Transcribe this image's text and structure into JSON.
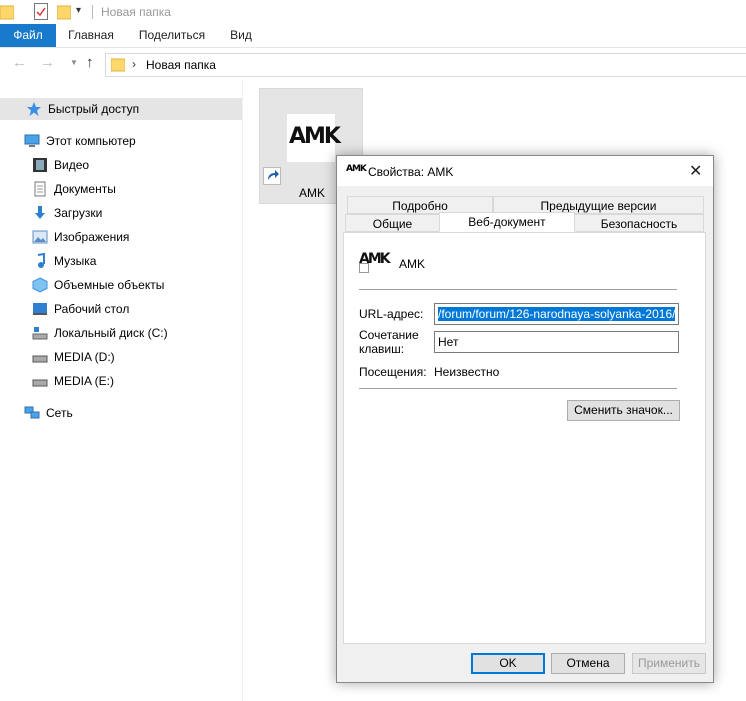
{
  "window": {
    "title": "Новая папка"
  },
  "ribbon": {
    "tabs": [
      "Файл",
      "Главная",
      "Поделиться",
      "Вид"
    ]
  },
  "address": {
    "path": "Новая папка"
  },
  "sidebar": {
    "items": [
      {
        "label": "Быстрый доступ",
        "icon": "star-icon"
      },
      {
        "label": "Этот компьютер",
        "icon": "computer-icon"
      },
      {
        "label": "Видео",
        "icon": "video-icon"
      },
      {
        "label": "Документы",
        "icon": "documents-icon"
      },
      {
        "label": "Загрузки",
        "icon": "download-icon"
      },
      {
        "label": "Изображения",
        "icon": "pictures-icon"
      },
      {
        "label": "Музыка",
        "icon": "music-icon"
      },
      {
        "label": "Объемные объекты",
        "icon": "3d-objects-icon"
      },
      {
        "label": "Рабочий стол",
        "icon": "desktop-icon"
      },
      {
        "label": "Локальный диск (C:)",
        "icon": "local-disk-icon"
      },
      {
        "label": "MEDIA (D:)",
        "icon": "drive-icon"
      },
      {
        "label": "MEDIA (E:)",
        "icon": "drive-icon"
      },
      {
        "label": "Сеть",
        "icon": "network-icon"
      }
    ]
  },
  "file": {
    "name": "AMK",
    "thumb_text": "AMK"
  },
  "dialog": {
    "title": "Свойства: AMK",
    "tabs_top": [
      "Подробно",
      "Предыдущие версии"
    ],
    "tabs_bottom": [
      "Общие",
      "Веб-документ",
      "Безопасность"
    ],
    "icon_text": "AMK",
    "name": "AMK",
    "url_label": "URL-адрес:",
    "url_value": "/forum/forum/126-narodnaya-solyanka-2016/",
    "shortcut_label_1": "Сочетание",
    "shortcut_label_2": "клавиш:",
    "shortcut_value": "Нет",
    "visits_label": "Посещения:",
    "visits_value": "Неизвестно",
    "change_icon_button": "Сменить значок...",
    "ok_button": "OK",
    "cancel_button": "Отмена",
    "apply_button": "Применить"
  },
  "colors": {
    "accent": "#1979ca",
    "selection": "#0078d7",
    "sidebar_selected": "#e5e5e5"
  }
}
